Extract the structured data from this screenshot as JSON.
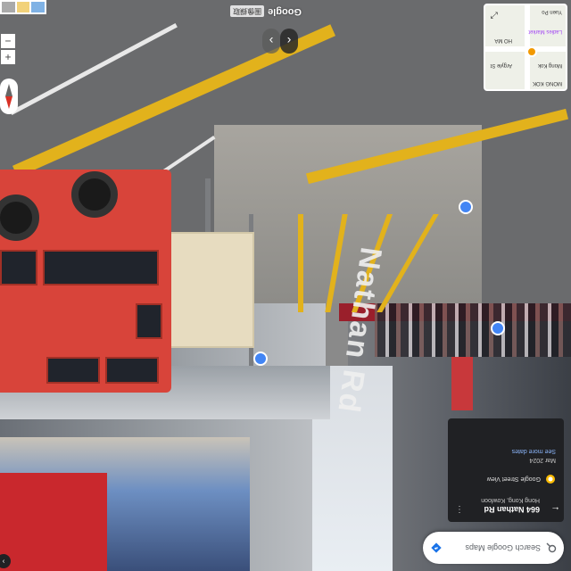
{
  "search": {
    "placeholder": "Search Google Maps"
  },
  "info_card": {
    "title": "664 Nathan Rd",
    "subtitle": "Hong Kong, Kowloon",
    "source": "Google Street View",
    "date": "Mar 2024",
    "see_more": "See more dates"
  },
  "street_label": "Nathan Rd",
  "minimap": {
    "labels": [
      "MONG KOK",
      "Ladies Market",
      "Argyle St",
      "HO MA",
      "Yuen Po",
      "Mong Kok"
    ]
  },
  "footer": {
    "brand": "Google",
    "imagery": "圖像擷取"
  },
  "colors": {
    "lane_yellow": "#e2b21c",
    "bus_red": "#d8443a",
    "sv_blue": "#4285f4"
  }
}
